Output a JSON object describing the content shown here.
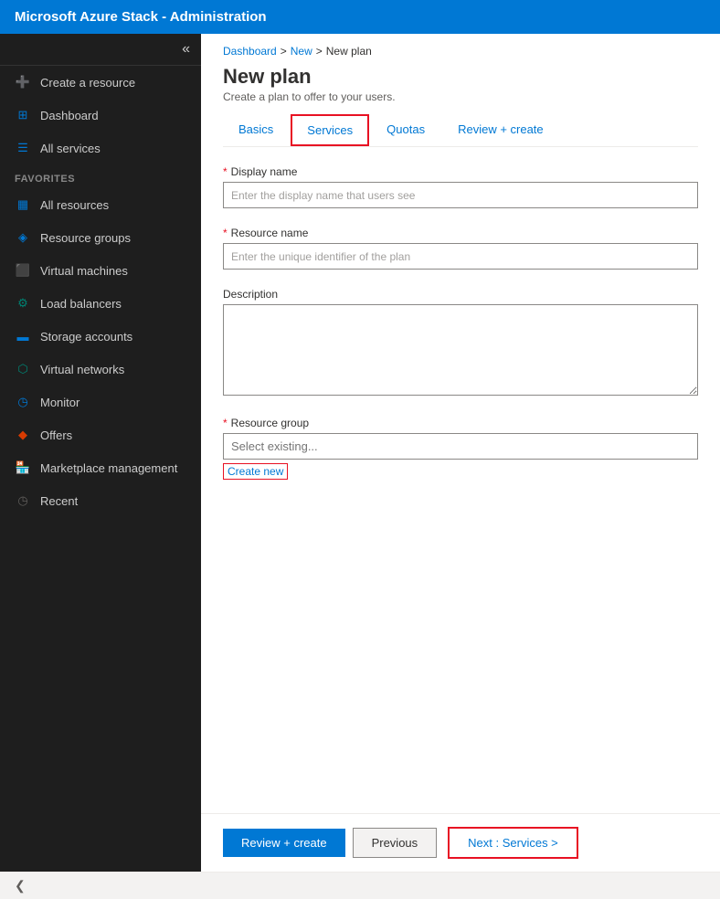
{
  "titleBar": {
    "text": "Microsoft Azure Stack - Administration"
  },
  "sidebar": {
    "collapseIcon": "«",
    "items": [
      {
        "id": "create-resource",
        "label": "Create a resource",
        "icon": "➕",
        "iconColor": "icon-blue"
      },
      {
        "id": "dashboard",
        "label": "Dashboard",
        "icon": "⊞",
        "iconColor": "icon-blue"
      },
      {
        "id": "all-services",
        "label": "All services",
        "icon": "☰",
        "iconColor": "icon-blue"
      },
      {
        "id": "favorites-section",
        "label": "FAVORITES",
        "isSection": true
      },
      {
        "id": "all-resources",
        "label": "All resources",
        "icon": "▦",
        "iconColor": "icon-blue"
      },
      {
        "id": "resource-groups",
        "label": "Resource groups",
        "icon": "◈",
        "iconColor": "icon-blue"
      },
      {
        "id": "virtual-machines",
        "label": "Virtual machines",
        "icon": "⬛",
        "iconColor": "icon-blue"
      },
      {
        "id": "load-balancers",
        "label": "Load balancers",
        "icon": "⚙",
        "iconColor": "icon-teal"
      },
      {
        "id": "storage-accounts",
        "label": "Storage accounts",
        "icon": "▬",
        "iconColor": "icon-blue"
      },
      {
        "id": "virtual-networks",
        "label": "Virtual networks",
        "icon": "⬡",
        "iconColor": "icon-teal"
      },
      {
        "id": "monitor",
        "label": "Monitor",
        "icon": "◷",
        "iconColor": "icon-blue"
      },
      {
        "id": "offers",
        "label": "Offers",
        "icon": "◆",
        "iconColor": "icon-yellow"
      },
      {
        "id": "marketplace-management",
        "label": "Marketplace management",
        "icon": "🏪",
        "iconColor": "icon-blue"
      },
      {
        "id": "recent",
        "label": "Recent",
        "icon": "◷",
        "iconColor": "icon-gray"
      }
    ]
  },
  "breadcrumb": {
    "items": [
      "Dashboard",
      "New",
      "New plan"
    ],
    "separator": ">"
  },
  "page": {
    "title": "New plan",
    "subtitle": "Create a plan to offer to your users."
  },
  "tabs": [
    {
      "id": "basics",
      "label": "Basics",
      "active": true,
      "highlighted": false
    },
    {
      "id": "services",
      "label": "Services",
      "active": false,
      "highlighted": true
    },
    {
      "id": "quotas",
      "label": "Quotas",
      "active": false,
      "highlighted": false
    },
    {
      "id": "review-create",
      "label": "Review + create",
      "active": false,
      "highlighted": false
    }
  ],
  "form": {
    "displayName": {
      "label": "Display name",
      "required": true,
      "placeholder": "Enter the display name that users see",
      "value": ""
    },
    "resourceName": {
      "label": "Resource name",
      "required": true,
      "placeholder": "Enter the unique identifier of the plan",
      "value": ""
    },
    "description": {
      "label": "Description",
      "required": false,
      "value": ""
    },
    "resourceGroup": {
      "label": "Resource group",
      "required": true,
      "placeholder": "Select existing...",
      "value": ""
    },
    "createNewLink": "Create new"
  },
  "footer": {
    "reviewCreate": "Review + create",
    "previous": "Previous",
    "nextServices": "Next : Services >"
  },
  "bottomBar": {
    "chevron": "❮"
  }
}
